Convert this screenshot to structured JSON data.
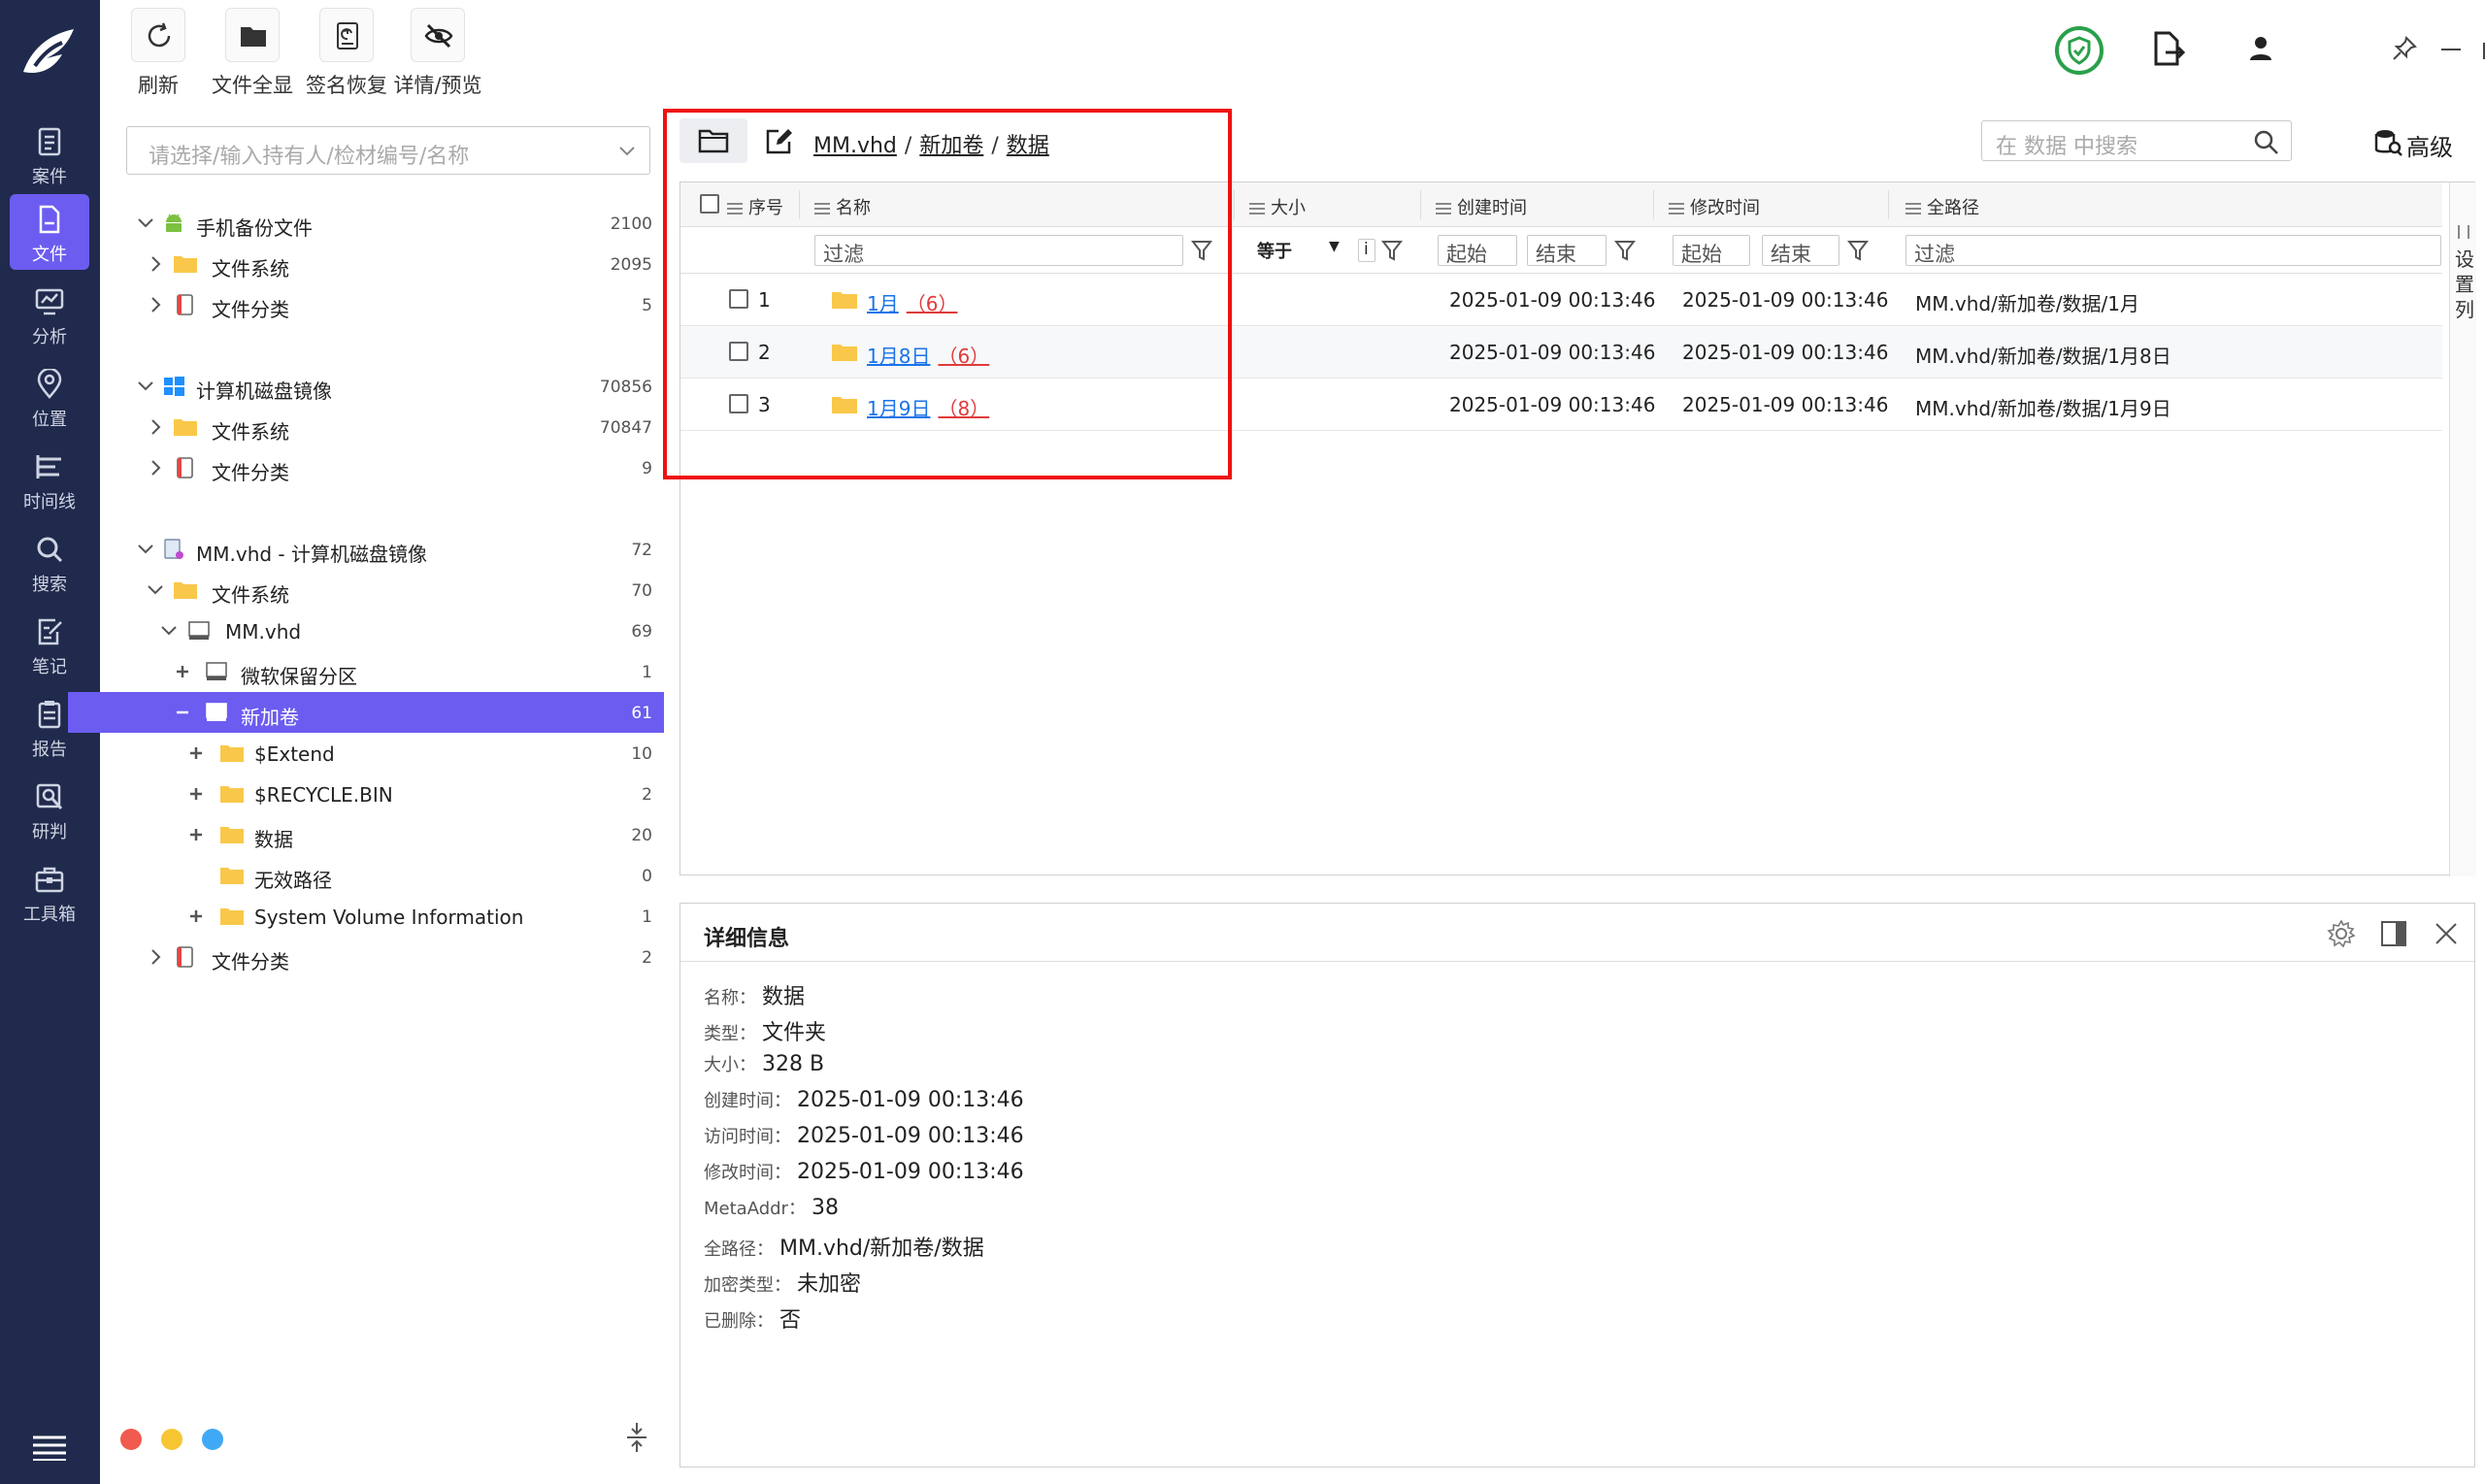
{
  "rail": {
    "items": [
      {
        "label": "案件",
        "icon": "case-icon"
      },
      {
        "label": "文件",
        "icon": "file-icon"
      },
      {
        "label": "分析",
        "icon": "analysis-icon"
      },
      {
        "label": "位置",
        "icon": "location-icon"
      },
      {
        "label": "时间线",
        "icon": "timeline-icon"
      },
      {
        "label": "搜索",
        "icon": "search-icon"
      },
      {
        "label": "笔记",
        "icon": "note-icon"
      },
      {
        "label": "报告",
        "icon": "report-icon"
      },
      {
        "label": "研判",
        "icon": "judgement-icon"
      },
      {
        "label": "工具箱",
        "icon": "toolbox-icon"
      }
    ],
    "active_index": 1
  },
  "toolbar": {
    "buttons": [
      {
        "label": "刷新",
        "icon": "refresh-icon"
      },
      {
        "label": "文件全显",
        "icon": "folder-icon"
      },
      {
        "label": "签名恢复",
        "icon": "signature-recover-icon"
      },
      {
        "label": "详情/预览",
        "icon": "eye-off-icon"
      }
    ]
  },
  "tree": {
    "case_select_placeholder": "请选择/输入持有人/检材编号/名称",
    "nodes": [
      {
        "label": "手机备份文件",
        "count": "2100",
        "icon": "android-icon",
        "toggle": "chevron-down"
      },
      {
        "label": "文件系统",
        "count": "2095",
        "icon": "folder-icon",
        "toggle": "chevron-right"
      },
      {
        "label": "文件分类",
        "count": "5",
        "icon": "category-icon",
        "toggle": "chevron-right"
      },
      {
        "label": "计算机磁盘镜像",
        "count": "70856",
        "icon": "windows-icon",
        "toggle": "chevron-down"
      },
      {
        "label": "文件系统",
        "count": "70847",
        "icon": "folder-icon",
        "toggle": "chevron-right"
      },
      {
        "label": "文件分类",
        "count": "9",
        "icon": "category-icon",
        "toggle": "chevron-right"
      },
      {
        "label": "MM.vhd - 计算机磁盘镜像",
        "count": "72",
        "icon": "disk-image-icon",
        "toggle": "chevron-down"
      },
      {
        "label": "文件系统",
        "count": "70",
        "icon": "folder-icon",
        "toggle": "chevron-down"
      },
      {
        "label": "MM.vhd",
        "count": "69",
        "icon": "drive-icon",
        "toggle": "chevron-down"
      },
      {
        "label": "微软保留分区",
        "count": "1",
        "icon": "drive-icon",
        "toggle": "plus"
      },
      {
        "label": "新加卷",
        "count": "61",
        "icon": "drive-icon",
        "toggle": "minus"
      },
      {
        "label": "$Extend",
        "count": "10",
        "icon": "folder-icon",
        "toggle": "plus"
      },
      {
        "label": "$RECYCLE.BIN",
        "count": "2",
        "icon": "folder-icon",
        "toggle": "plus"
      },
      {
        "label": "数据",
        "count": "20",
        "icon": "folder-icon",
        "toggle": "plus"
      },
      {
        "label": "无效路径",
        "count": "0",
        "icon": "folder-icon",
        "toggle": "none"
      },
      {
        "label": "System Volume Information",
        "count": "1",
        "icon": "folder-icon",
        "toggle": "plus"
      },
      {
        "label": "文件分类",
        "count": "2",
        "icon": "category-icon",
        "toggle": "chevron-right"
      }
    ],
    "selected_index": 10,
    "status_dots": [
      "#f05a4f",
      "#f7c531",
      "#3fa9f5"
    ]
  },
  "list": {
    "breadcrumb": [
      "MM.vhd",
      "新加卷",
      "数据"
    ],
    "breadcrumb_sep": "/",
    "search_placeholder": "在 数据 中搜索",
    "advanced_label": "高级",
    "columns": [
      "序号",
      "名称",
      "大小",
      "创建时间",
      "修改时间",
      "全路径"
    ],
    "filters": {
      "name": "过滤",
      "size_op": "等于",
      "size_info": "i",
      "created_start": "起始",
      "created_end": "结束",
      "modified_start": "起始",
      "modified_end": "结束",
      "path": "过滤"
    },
    "rows": [
      {
        "index": "1",
        "name": "1月",
        "count": "（6）",
        "created": "2025-01-09 00:13:46",
        "modified": "2025-01-09 00:13:46",
        "path": "MM.vhd/新加卷/数据/1月"
      },
      {
        "index": "2",
        "name": "1月8日",
        "count": "（6）",
        "created": "2025-01-09 00:13:46",
        "modified": "2025-01-09 00:13:46",
        "path": "MM.vhd/新加卷/数据/1月8日"
      },
      {
        "index": "3",
        "name": "1月9日",
        "count": "（8）",
        "created": "2025-01-09 00:13:46",
        "modified": "2025-01-09 00:13:46",
        "path": "MM.vhd/新加卷/数据/1月9日"
      }
    ],
    "set_columns_label": [
      "设",
      "置",
      "列"
    ],
    "highlight_color": "#ee1111"
  },
  "detail": {
    "title": "详细信息",
    "props": [
      {
        "key": "名称：",
        "value": "数据"
      },
      {
        "key": "类型：",
        "value": "文件夹"
      },
      {
        "key": "大小：",
        "value": "328 B"
      },
      {
        "key": "创建时间：",
        "value": "2025-01-09 00:13:46"
      },
      {
        "key": "访问时间：",
        "value": "2025-01-09 00:13:46"
      },
      {
        "key": "修改时间：",
        "value": "2025-01-09 00:13:46"
      },
      {
        "key": "MetaAddr：",
        "value": "38"
      },
      {
        "key": "全路径：",
        "value": "MM.vhd/新加卷/数据"
      },
      {
        "key": "加密类型：",
        "value": "未加密"
      },
      {
        "key": "已删除：",
        "value": "否"
      }
    ]
  },
  "colors": {
    "rail_bg": "#1f2a4c",
    "accent": "#6c5cf0",
    "link": "#1a73e8",
    "count_red": "#e03b3b",
    "shield_green": "#2aa04a"
  }
}
